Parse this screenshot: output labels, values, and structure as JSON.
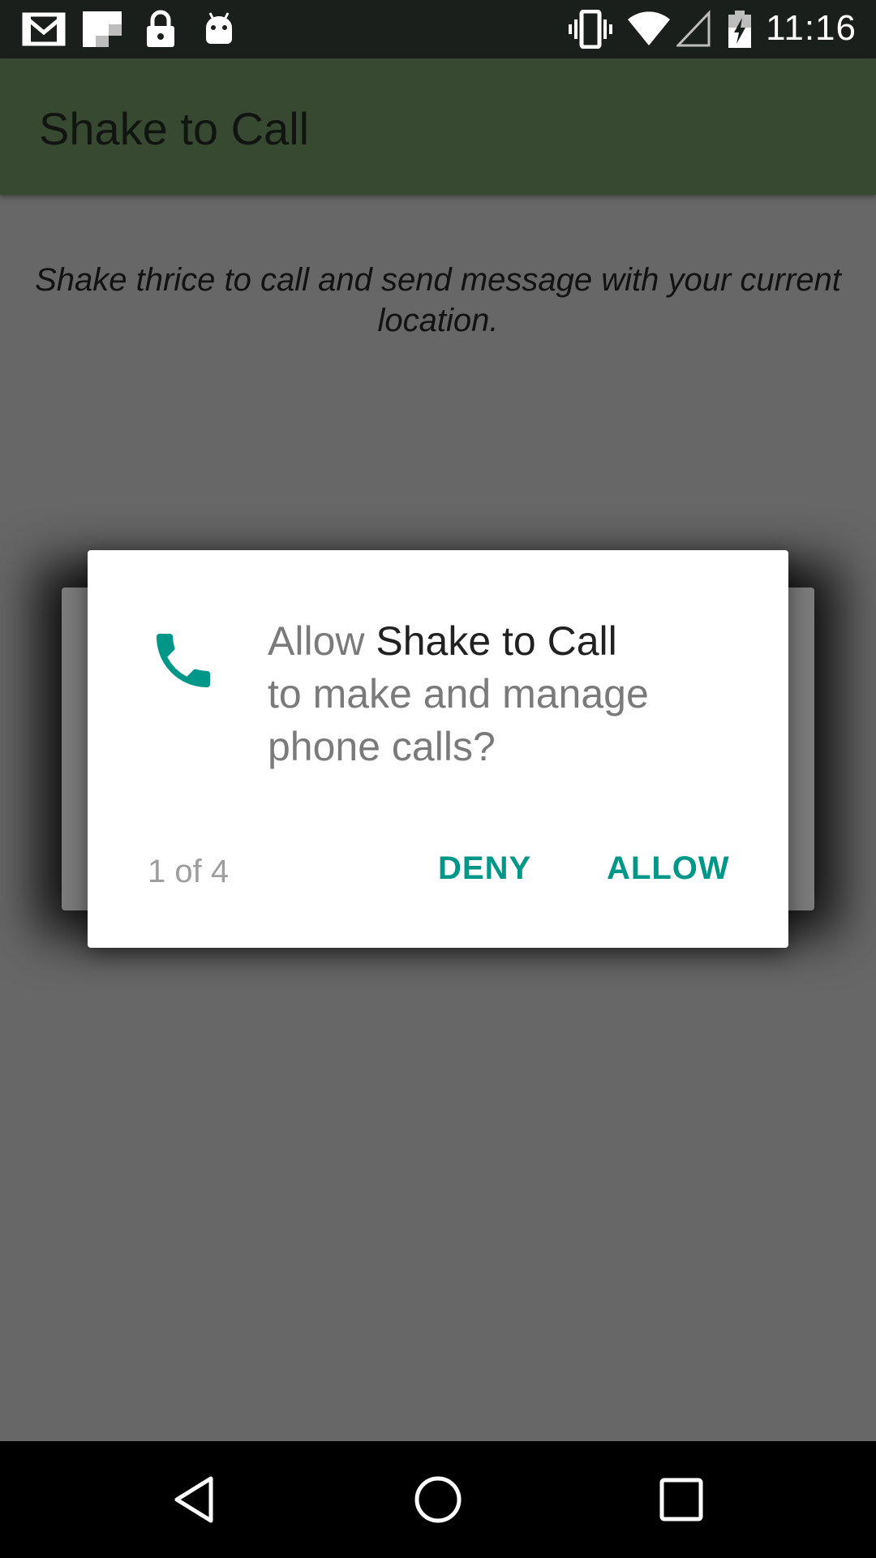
{
  "status_bar": {
    "time": "11:16",
    "icons": [
      "gmail-icon",
      "flipboard-icon",
      "lock-icon",
      "android-icon",
      "vibrate-icon",
      "wifi-icon",
      "signal-icon",
      "battery-charging-icon"
    ]
  },
  "app_bar": {
    "title": "Shake to Call"
  },
  "content": {
    "description": "Shake thrice to call and send message with your current location."
  },
  "dialog": {
    "icon": "phone-icon",
    "message_prefix": "Allow ",
    "app_name": "Shake to Call",
    "message_suffix": "to make and manage phone calls?",
    "counter": "1 of 4",
    "deny_label": "DENY",
    "allow_label": "ALLOW",
    "accent_color": "#009688"
  },
  "nav_bar": {
    "buttons": [
      "back-icon",
      "home-icon",
      "recents-icon"
    ]
  },
  "colors": {
    "app_bar": "#374a31",
    "status_bar": "#1b1f1b",
    "scrim": "#676767"
  }
}
